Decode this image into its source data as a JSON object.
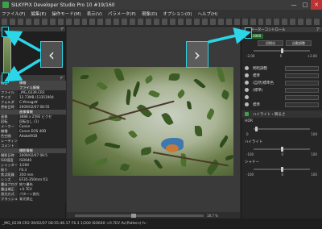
{
  "app": {
    "title": "SILKYPIX Developer Studio Pro 10   #19/160"
  },
  "window_controls": {
    "minimize": "—",
    "maximize": "□",
    "close": "✕"
  },
  "menu": [
    "ファイル(F)",
    "編集(E)",
    "操作モード(M)",
    "表示(V)",
    "パラメータ(P)",
    "現像(D)",
    "オプション(O)",
    "ヘルプ(H)"
  ],
  "left_panel": {
    "thumb_header": "ア",
    "info_header": "ア",
    "info_rows": [
      {
        "k": "項目",
        "v": "情報",
        "section": true
      },
      {
        "k": "",
        "v": "ファイル情報",
        "section": true
      },
      {
        "k": "ファイル",
        "v": "_MG_0239.CR2"
      },
      {
        "k": "サイズ",
        "v": "12.73MB (13351904"
      },
      {
        "k": "フォルダ",
        "v": "C:¥image¥"
      },
      {
        "k": "更新日時",
        "v": "2009/02/07 08:55"
      },
      {
        "k": "",
        "v": "画像情報",
        "section": true
      },
      {
        "k": "画像",
        "v": "3888 x 2592 ビクセ"
      },
      {
        "k": "回転",
        "v": "回転なし (1)"
      },
      {
        "k": "メーカー",
        "v": "Canon"
      },
      {
        "k": "機種",
        "v": "Canon EOS 40D"
      },
      {
        "k": "色空間",
        "v": "AdobeRGB"
      },
      {
        "k": "レーティング",
        "v": ""
      },
      {
        "k": "コメント",
        "v": ""
      },
      {
        "k": "",
        "v": "撮影情報",
        "section": true
      },
      {
        "k": "撮影日時",
        "v": "2009/02/07 08:5"
      },
      {
        "k": "ISO感度",
        "v": "ISO640"
      },
      {
        "k": "シャッター",
        "v": "1/200"
      },
      {
        "k": "絞り",
        "v": "F6.3"
      },
      {
        "k": "焦点距離",
        "v": "350 mm"
      },
      {
        "k": "レンズ",
        "v": "EF35-350mm f/3."
      },
      {
        "k": "露出プログラム",
        "v": "絞り優先"
      },
      {
        "k": "露出補正",
        "v": "+0.7EV"
      },
      {
        "k": "測光方式",
        "v": "パターン測光"
      },
      {
        "k": "フラッシュ",
        "v": "発光禁止"
      }
    ]
  },
  "center": {
    "zoom": "18.7 %"
  },
  "right_panel": {
    "header": "パラメーターコントロール",
    "header_btn": "ア",
    "value_box": "2000",
    "btn_left": "初期化",
    "btn_right": "自動調整",
    "scale_low": "-2.00",
    "scale_mid": "0",
    "scale_high": "+2.00",
    "params": [
      {
        "label": "明暗調整",
        "dd": ""
      },
      {
        "label": "標準",
        "dd": ""
      },
      {
        "label": "(自然)標準色",
        "dd": ""
      },
      {
        "label": "(標準)",
        "dd": ""
      },
      {
        "label": "",
        "dd": ""
      },
      {
        "label": "標準",
        "dd": ""
      }
    ],
    "hl_label": "ハイライト・明るさ",
    "hdr_label": "HDR",
    "hdr_low": "0",
    "hdr_high": "100",
    "hi_label": "ハイライト",
    "hi_low": "-100",
    "hi_mid": "0",
    "hi_high": "100",
    "sh_label": "シャドー",
    "sh_low": "-100",
    "sh_mid": "0",
    "sh_high": "100"
  },
  "status": "_MG_0239.CR2 09/02/07 08:55:46.17 F6.3 1/200 ISO640 +0.7EV Av(Pattern) h--",
  "nav": {
    "prev": "‹",
    "next": "›"
  },
  "colors": {
    "highlight": "#2bd6e8",
    "accent_green": "#1f6a2a"
  }
}
